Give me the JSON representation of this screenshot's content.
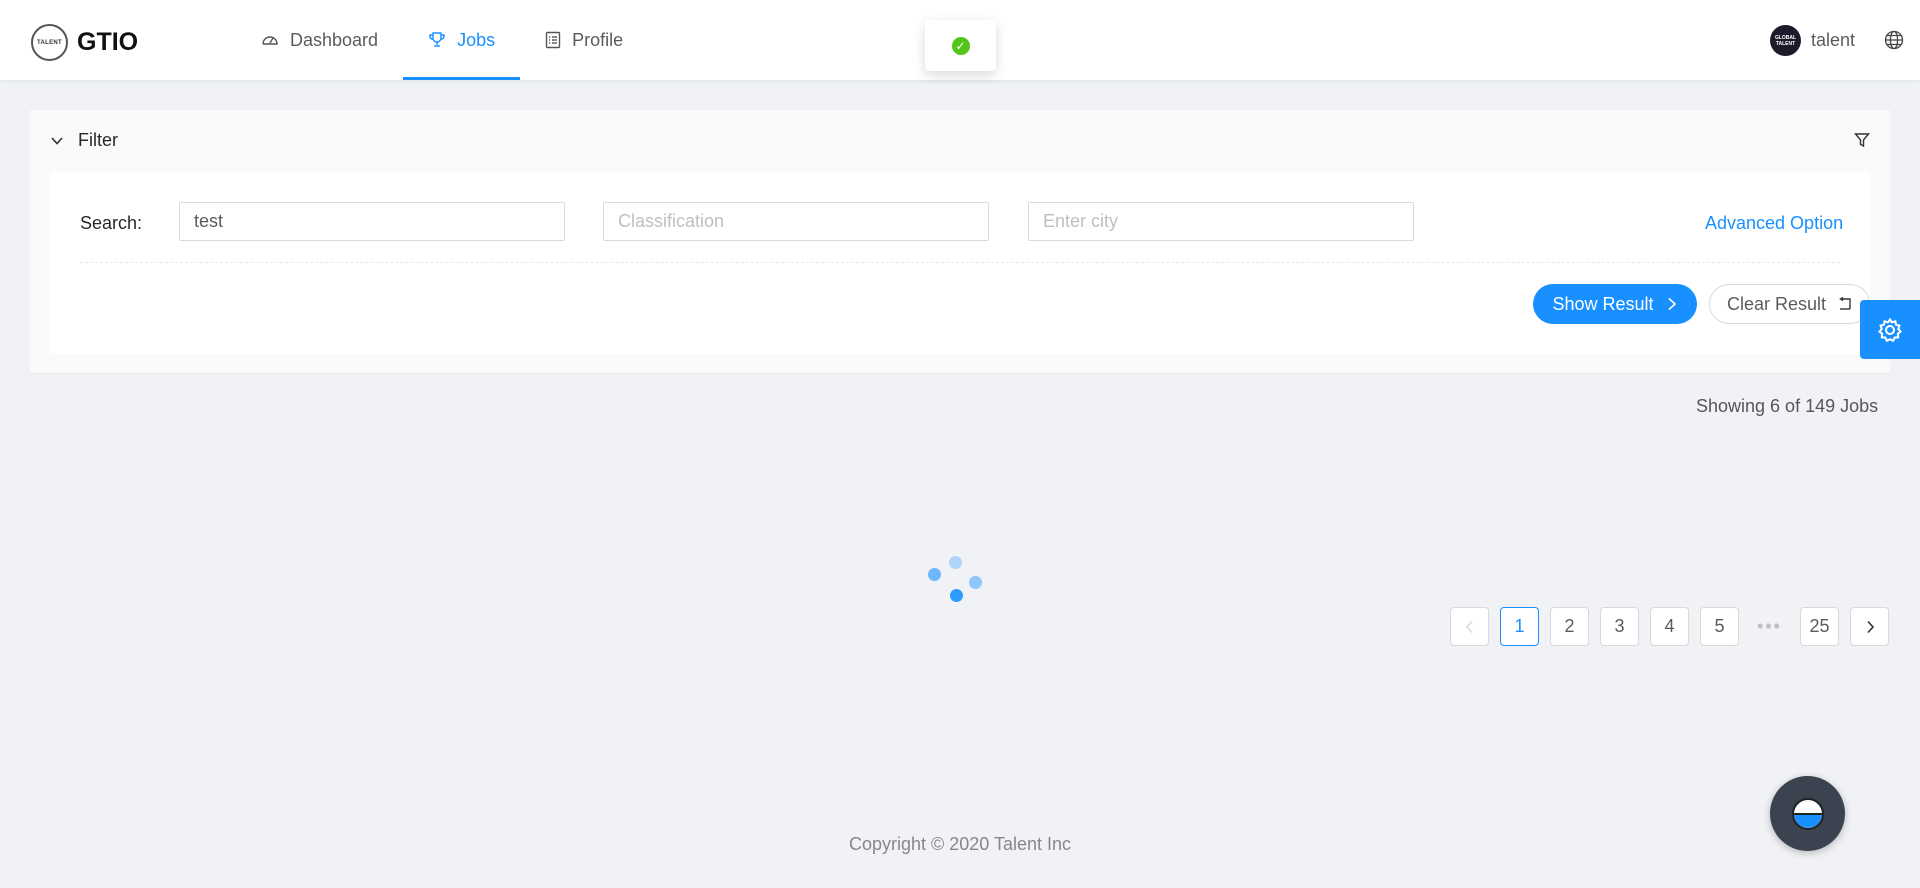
{
  "header": {
    "logo_badge": "TALENT",
    "brand": "GTIO",
    "nav": [
      {
        "label": "Dashboard",
        "icon": "dashboard-icon"
      },
      {
        "label": "Jobs",
        "icon": "trophy-icon",
        "active": true
      },
      {
        "label": "Profile",
        "icon": "profile-icon"
      }
    ],
    "user": {
      "name": "talent",
      "avatar_text": "GLOBAL TALENT"
    },
    "toast_icon": "check-circle-icon"
  },
  "filter": {
    "title": "Filter",
    "search_label": "Search:",
    "search_value": "test",
    "classification_placeholder": "Classification",
    "city_placeholder": "Enter city",
    "advanced_link": "Advanced Option",
    "show_button": "Show Result",
    "clear_button": "Clear Result"
  },
  "results": {
    "count_text": "Showing 6 of 149 Jobs"
  },
  "pagination": {
    "pages": [
      "1",
      "2",
      "3",
      "4",
      "5"
    ],
    "ellipsis": "•••",
    "last": "25",
    "current": "1"
  },
  "footer": {
    "copyright": "Copyright © 2020 Talent Inc"
  },
  "colors": {
    "primary": "#1890ff",
    "success": "#52c41a",
    "background": "#f0f2f5"
  }
}
